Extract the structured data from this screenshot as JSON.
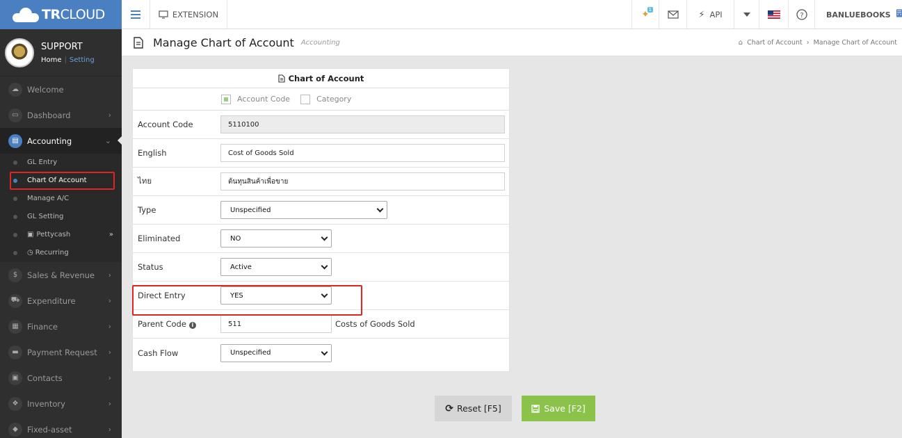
{
  "app": {
    "brand_bold": "TR",
    "brand_rest": "CLOUD"
  },
  "profile": {
    "name": "SUPPORT",
    "home": "Home",
    "sep": "|",
    "setting": "Setting"
  },
  "sidebar": {
    "items_top": [
      {
        "label": "Welcome",
        "icon": "cloud-icon"
      },
      {
        "label": "Dashboard",
        "icon": "monitor-icon"
      }
    ],
    "active": {
      "label": "Accounting",
      "icon": "book-icon"
    },
    "sub_items": [
      {
        "label": "GL Entry"
      },
      {
        "label": "Chart Of Account"
      },
      {
        "label": "Manage A/C"
      },
      {
        "label": "GL Setting"
      },
      {
        "label": "Pettycash",
        "icon": "cash-icon"
      },
      {
        "label": "Recurring",
        "icon": "clock-icon"
      }
    ],
    "items_bottom": [
      {
        "label": "Sales & Revenue",
        "icon": "dollar-icon"
      },
      {
        "label": "Expenditure",
        "icon": "cart-icon"
      },
      {
        "label": "Finance",
        "icon": "calendar-icon"
      },
      {
        "label": "Payment Request",
        "icon": "card-icon"
      },
      {
        "label": "Contacts",
        "icon": "contact-icon"
      },
      {
        "label": "Inventory",
        "icon": "cubes-icon"
      },
      {
        "label": "Fixed-asset",
        "icon": "tag-icon"
      }
    ]
  },
  "topbar": {
    "extension": "EXTENSION",
    "notification_count": "1",
    "api": "API",
    "company": "BANLUEBOOKS"
  },
  "page": {
    "title": "Manage Chart of Account",
    "subtitle": "Accounting",
    "breadcrumb": [
      "Chart of Account",
      "Manage Chart of Account"
    ]
  },
  "form": {
    "panel_title": "Chart of Account",
    "option_account_code": "Account Code",
    "option_category": "Category",
    "account_code": {
      "label": "Account Code",
      "value": "5110100"
    },
    "english": {
      "label": "English",
      "value": "Cost of Goods Sold"
    },
    "thai": {
      "label": "ไทย",
      "value": "ต้นทุนสินค้าเพื่อขาย"
    },
    "type": {
      "label": "Type",
      "value": "Unspecified"
    },
    "eliminated": {
      "label": "Eliminated",
      "value": "NO"
    },
    "status": {
      "label": "Status",
      "value": "Active"
    },
    "direct_entry": {
      "label": "Direct Entry",
      "value": "YES"
    },
    "parent_code": {
      "label": "Parent Code",
      "value": "511",
      "name": "Costs of Goods Sold"
    },
    "cash_flow": {
      "label": "Cash Flow",
      "value": "Unspecified"
    }
  },
  "actions": {
    "reset": "Reset [F5]",
    "save": "Save [F2]"
  },
  "colors": {
    "brand": "#4a7fc1",
    "save": "#8bc34a",
    "highlight": "#e02424"
  }
}
